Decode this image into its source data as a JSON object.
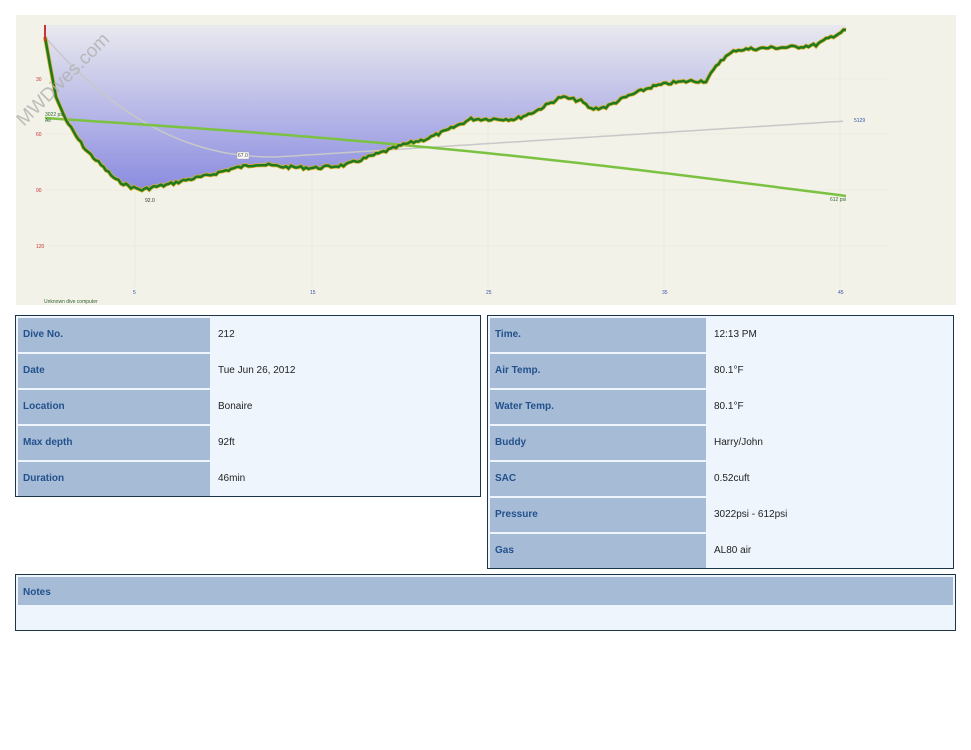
{
  "profile": {
    "watermark": "MWDives.com",
    "background": "#f2f2e8",
    "depth_ticks": [
      "30",
      "60",
      "90",
      "120"
    ],
    "time_ticks": [
      "5",
      "15",
      "25",
      "35",
      "45"
    ],
    "pressure_start_label": "3022 psi",
    "pressure_start_gas": "Air",
    "pressure_end_label": "612 psi",
    "max_depth_label": "92.0",
    "mid_label": "67.0",
    "right_label": "5129",
    "computer_label": "Unknown dive computer",
    "colors": {
      "depth_fill_top": "#e9e9ef",
      "depth_fill_bottom": "#8a8be0",
      "depth_line": "#1f7a1f",
      "pressure_line": "#7cc242",
      "gray_line": "#c8c8c8",
      "tick_red": "#cc3333",
      "tick_blue": "#3355aa"
    }
  },
  "info_left": [
    {
      "key": "Dive No.",
      "value": "212"
    },
    {
      "key": "Date",
      "value": "Tue Jun 26, 2012"
    },
    {
      "key": "Location",
      "value": "Bonaire"
    },
    {
      "key": "Max depth",
      "value": "92ft"
    },
    {
      "key": "Duration",
      "value": "46min"
    }
  ],
  "info_right": [
    {
      "key": "Time.",
      "value": "12:13 PM"
    },
    {
      "key": "Air Temp.",
      "value": "80.1°F"
    },
    {
      "key": "Water Temp.",
      "value": "80.1°F"
    },
    {
      "key": "Buddy",
      "value": "Harry/John"
    },
    {
      "key": "SAC",
      "value": "0.52cuft"
    },
    {
      "key": "Pressure",
      "value": "3022psi - 612psi"
    },
    {
      "key": "Gas",
      "value": "AL80 air"
    }
  ],
  "notes": {
    "title": "Notes",
    "body": ""
  }
}
